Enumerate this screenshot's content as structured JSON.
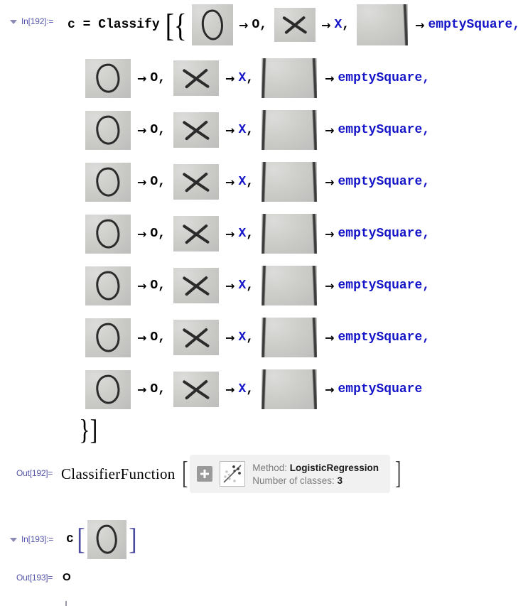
{
  "notebook": {
    "cells": [
      {
        "kind": "input",
        "label": "In[192]:=",
        "collapse_icon": "triangle-down-icon"
      },
      {
        "kind": "output",
        "label": "Out[192]=",
        "head": "ClassifierFunction"
      },
      {
        "kind": "input",
        "label": "In[193]:=",
        "collapse_icon": "triangle-down-icon"
      },
      {
        "kind": "output",
        "label": "Out[193]="
      }
    ]
  },
  "code": {
    "assignment": "c = Classify",
    "open_brackets": "[{",
    "close_brackets": "}]",
    "apply_symbol": "c",
    "arrow": "→",
    "comma": ",",
    "labels": {
      "o": "O",
      "x": "X",
      "empty": "emptySquare"
    },
    "colors": {
      "symbol_defined": "#1414c8",
      "symbol_builtin": "#000000",
      "cell_label": "#5555aa"
    }
  },
  "training_rows": [
    {
      "o": "O",
      "x": "X",
      "empty": "emptySquare",
      "trailing_comma": ","
    },
    {
      "o": "O",
      "x": "X",
      "empty": "emptySquare",
      "trailing_comma": ","
    },
    {
      "o": "O",
      "x": "X",
      "empty": "emptySquare",
      "trailing_comma": ","
    },
    {
      "o": "O",
      "x": "X",
      "empty": "emptySquare",
      "trailing_comma": ","
    },
    {
      "o": "O",
      "x": "X",
      "empty": "emptySquare",
      "trailing_comma": ","
    },
    {
      "o": "O",
      "x": "X",
      "empty": "emptySquare",
      "trailing_comma": ","
    },
    {
      "o": "O",
      "x": "X",
      "empty": "emptySquare",
      "trailing_comma": ","
    },
    {
      "o": "O",
      "x": "X",
      "empty": "emptySquare",
      "trailing_comma": ""
    }
  ],
  "classifier_summary": {
    "method_label": "Method:",
    "method_value": "LogisticRegression",
    "classes_label": "Number of classes:",
    "classes_value": "3",
    "expand_button": "plus-button",
    "icon": "classifier-scatter-icon"
  },
  "result": {
    "value": "O"
  }
}
